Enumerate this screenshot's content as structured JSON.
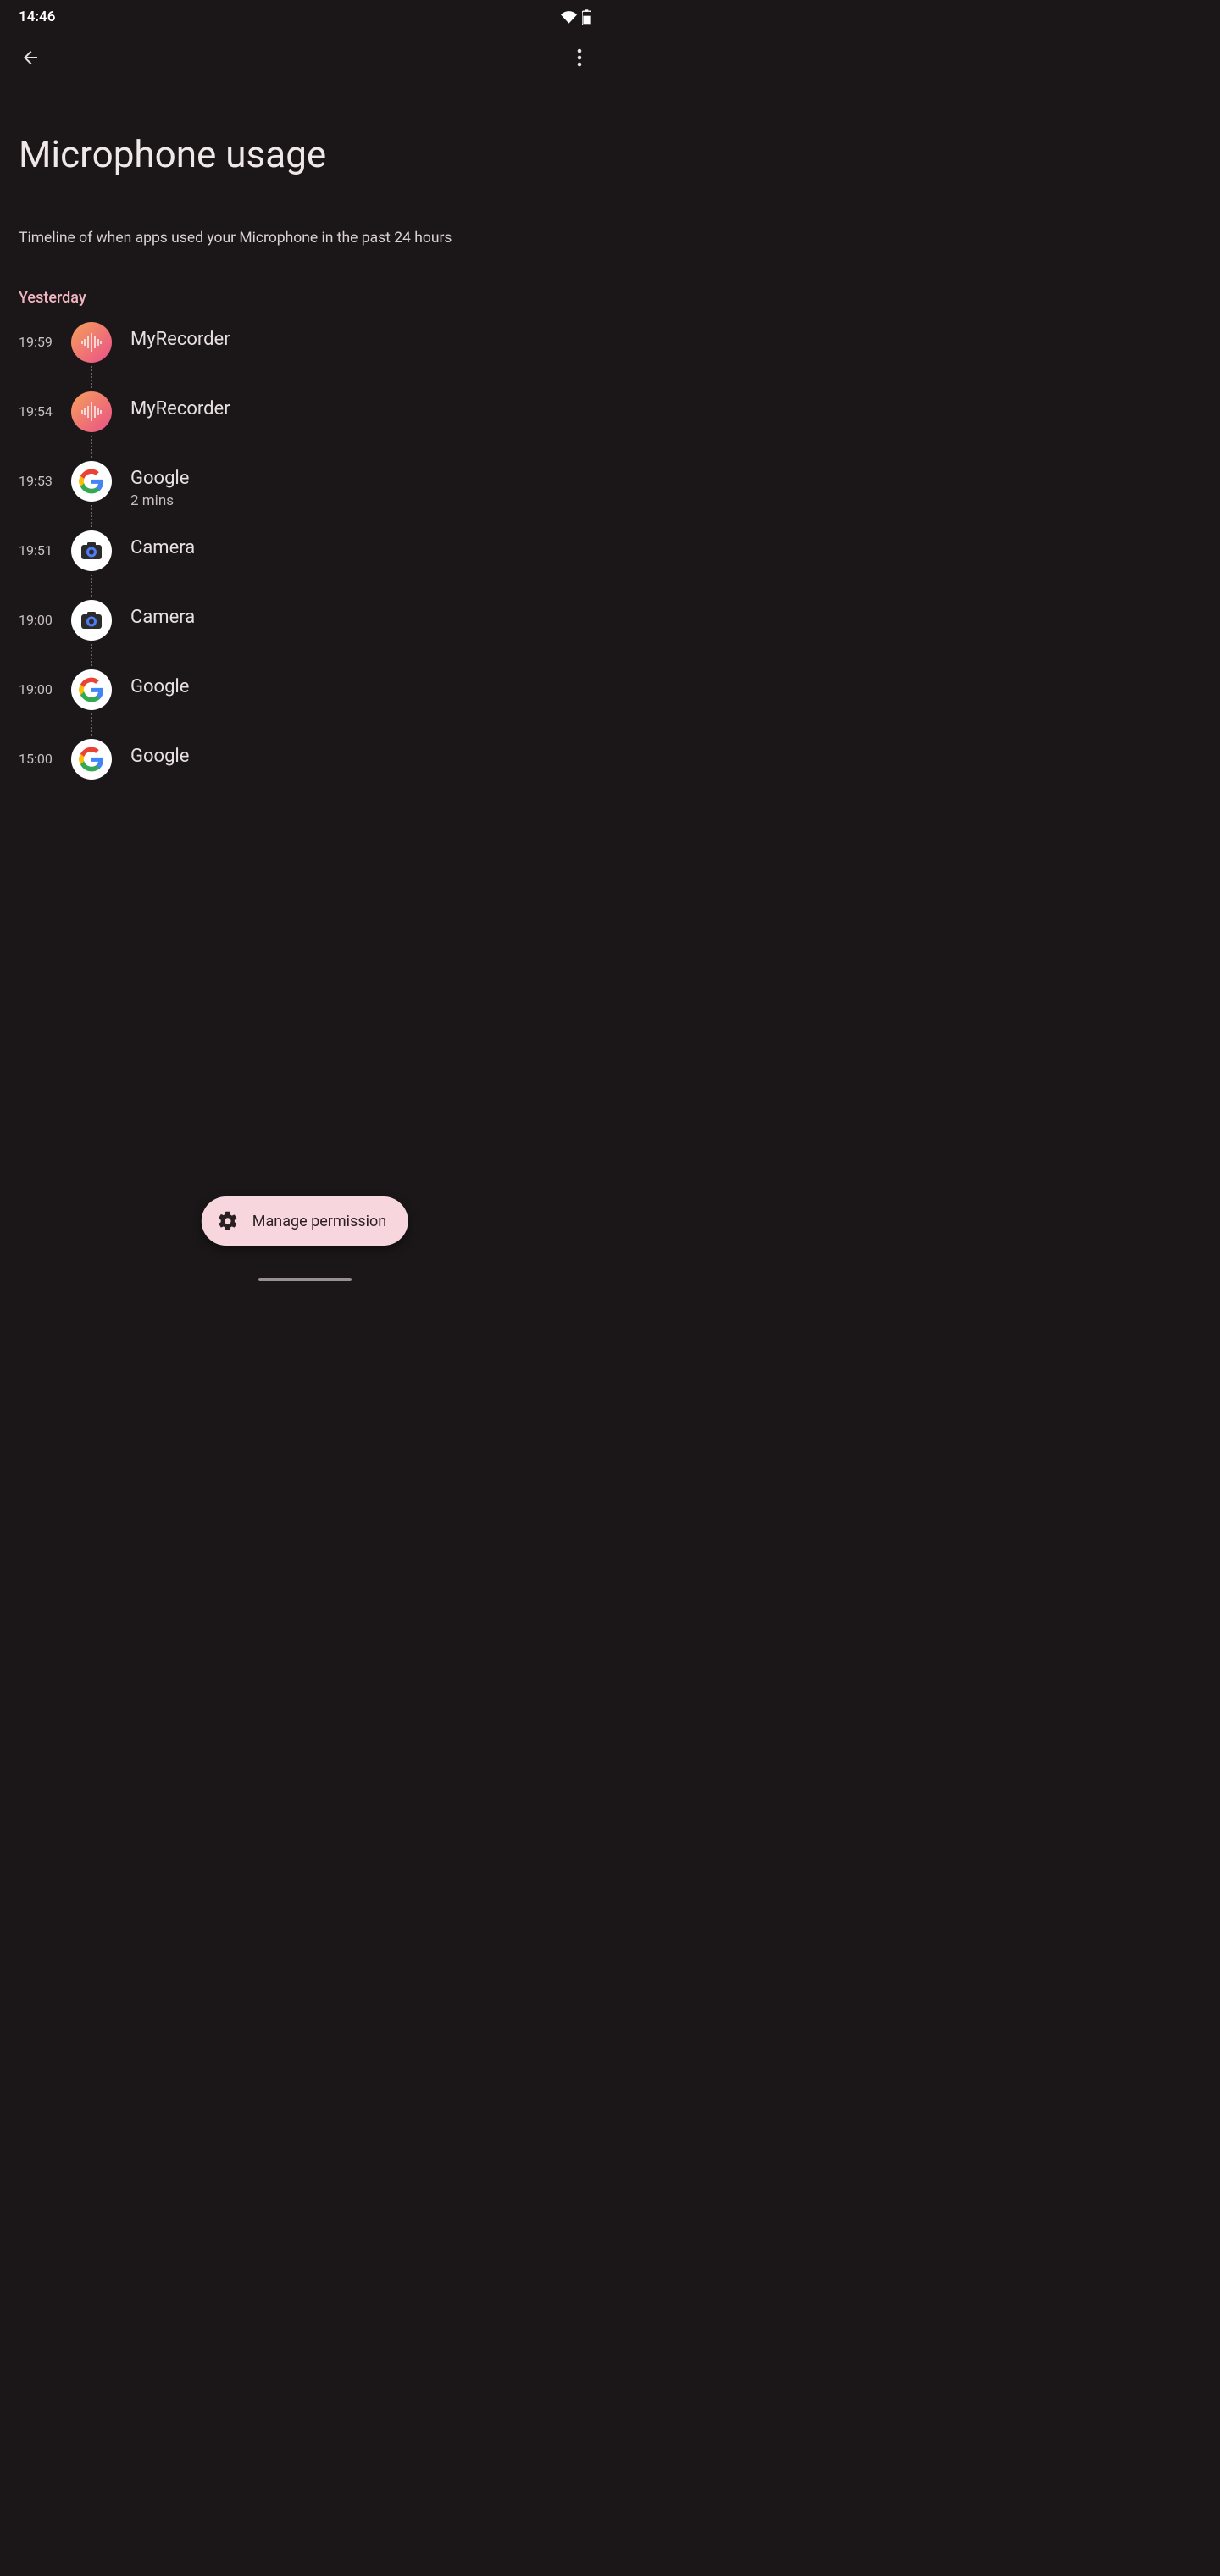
{
  "status": {
    "time": "14:46"
  },
  "header": {
    "title": "Microphone usage",
    "subtitle": "Timeline of when apps used your Microphone in the past 24 hours"
  },
  "section_label": "Yesterday",
  "entries": [
    {
      "time": "19:59",
      "app": "MyRecorder",
      "icon": "recorder",
      "duration": ""
    },
    {
      "time": "19:54",
      "app": "MyRecorder",
      "icon": "recorder",
      "duration": ""
    },
    {
      "time": "19:53",
      "app": "Google",
      "icon": "google",
      "duration": "2 mins"
    },
    {
      "time": "19:51",
      "app": "Camera",
      "icon": "camera",
      "duration": ""
    },
    {
      "time": "19:00",
      "app": "Camera",
      "icon": "camera",
      "duration": ""
    },
    {
      "time": "19:00",
      "app": "Google",
      "icon": "google",
      "duration": ""
    },
    {
      "time": "15:00",
      "app": "Google",
      "icon": "google",
      "duration": ""
    }
  ],
  "fab": {
    "label": "Manage permission"
  }
}
